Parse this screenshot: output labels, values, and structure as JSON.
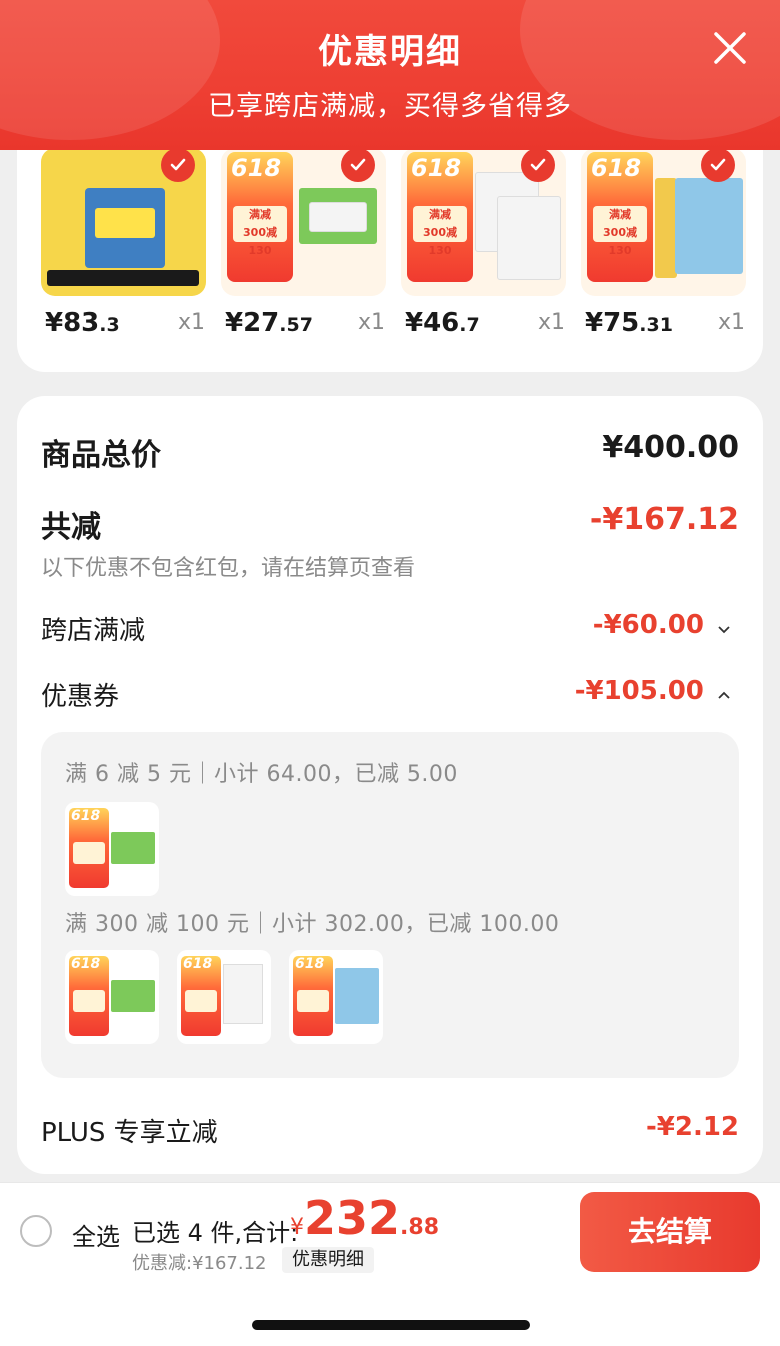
{
  "header": {
    "title": "优惠明细",
    "subtitle": "已享跨店满减，买得多省得多",
    "color": "#ee3f33"
  },
  "products": [
    {
      "price_int": "¥83",
      "price_frac": ".3",
      "qty": "x1",
      "checked": true
    },
    {
      "price_int": "¥27",
      "price_frac": ".57",
      "qty": "x1",
      "checked": true
    },
    {
      "price_int": "¥46",
      "price_frac": ".7",
      "qty": "x1",
      "checked": true
    },
    {
      "price_int": "¥75",
      "price_frac": ".31",
      "qty": "x1",
      "checked": true
    }
  ],
  "summary": {
    "total_label": "商品总价",
    "total_value": "¥400.00",
    "reduce_label": "共减",
    "reduce_value": "-¥167.12",
    "reduce_note": "以下优惠不包含红包，请在结算页查看",
    "cross_store_label": "跨店满减",
    "cross_store_value": "-¥60.00",
    "coupon_label": "优惠券",
    "coupon_value": "-¥105.00",
    "plus_label": "PLUS 专享立减",
    "plus_value": "-¥2.12"
  },
  "coupons": [
    {
      "text": "满 6 减 5 元｜小计 64.00，已减 5.00",
      "item_count": 1
    },
    {
      "text": "满 300 减 100 元｜小计 302.00，已减 100.00",
      "item_count": 3
    }
  ],
  "bottom": {
    "select_all": "全选",
    "selected_info": "已选 4 件,合计:",
    "total_currency": "¥",
    "total_int": "232",
    "total_dec": ".88",
    "discount_note": "优惠减:¥167.12",
    "detail_label": "优惠明细",
    "checkout_label": "去结算",
    "accent_color": "#e8412f"
  }
}
